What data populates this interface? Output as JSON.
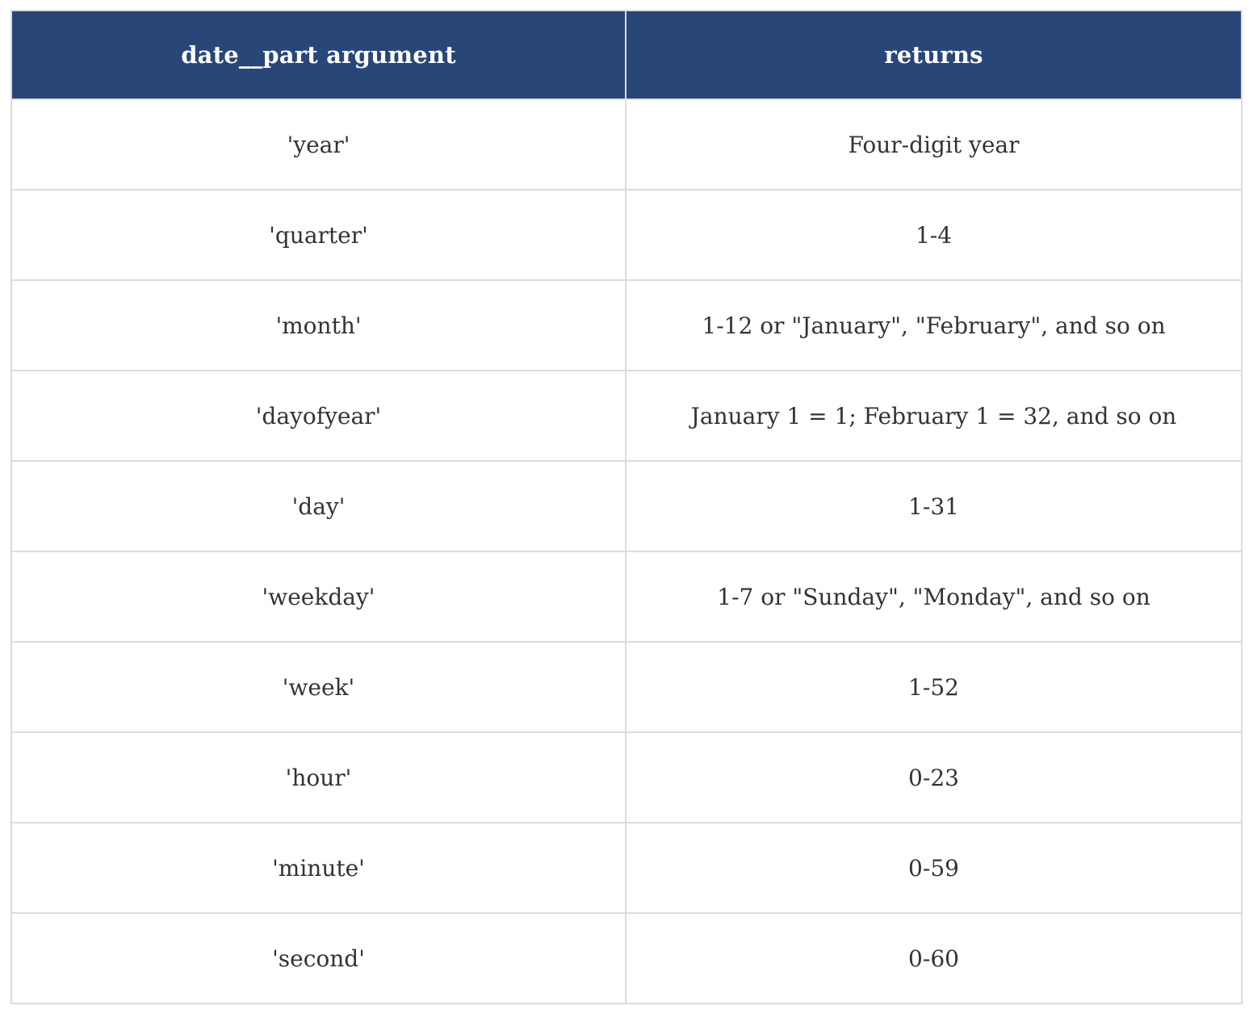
{
  "table": {
    "headers": [
      "date__part argument",
      "returns"
    ],
    "rows": [
      [
        "'year'",
        "Four-digit year"
      ],
      [
        "'quarter'",
        "1-4"
      ],
      [
        "'month'",
        "1-12 or \"January\", \"February\", and so on"
      ],
      [
        "'dayofyear'",
        "January 1 = 1; February 1 = 32, and so on"
      ],
      [
        "'day'",
        "1-31"
      ],
      [
        "'weekday'",
        "1-7 or \"Sunday\", \"Monday\", and so on"
      ],
      [
        "'week'",
        "1-52"
      ],
      [
        "'hour'",
        "0-23"
      ],
      [
        "'minute'",
        "0-59"
      ],
      [
        "'second'",
        "0-60"
      ]
    ]
  },
  "colors": {
    "header_bg": "#294679",
    "header_text": "#ffffff",
    "cell_text": "#333333",
    "border": "#dcdcdc"
  }
}
